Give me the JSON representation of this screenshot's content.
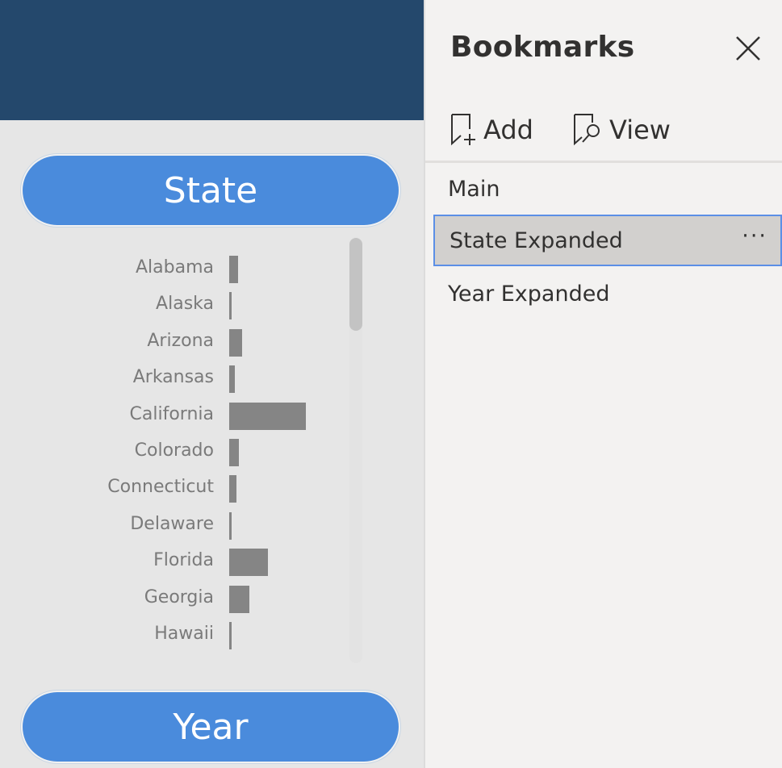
{
  "report": {
    "state_slicer": {
      "header": "State",
      "items": [
        {
          "label": "Alabama",
          "value": 0.12
        },
        {
          "label": "Alaska",
          "value": 0.02
        },
        {
          "label": "Arizona",
          "value": 0.17
        },
        {
          "label": "Arkansas",
          "value": 0.07
        },
        {
          "label": "California",
          "value": 1.0
        },
        {
          "label": "Colorado",
          "value": 0.13
        },
        {
          "label": "Connecticut",
          "value": 0.09
        },
        {
          "label": "Delaware",
          "value": 0.02
        },
        {
          "label": "Florida",
          "value": 0.51
        },
        {
          "label": "Georgia",
          "value": 0.26
        },
        {
          "label": "Hawaii",
          "value": 0.03
        }
      ],
      "bar_color": "#858585",
      "scroll_position": 0.0
    },
    "year_slicer": {
      "header": "Year"
    },
    "header_color": "#24486c",
    "pill_color": "#4a8bdc"
  },
  "bookmarks_pane": {
    "title": "Bookmarks",
    "add_label": "Add",
    "view_label": "View",
    "items": [
      {
        "label": "Main",
        "selected": false
      },
      {
        "label": "State Expanded",
        "selected": true
      },
      {
        "label": "Year Expanded",
        "selected": false
      }
    ],
    "more_glyph": "···",
    "selection_border_color": "#5b8fe6"
  }
}
